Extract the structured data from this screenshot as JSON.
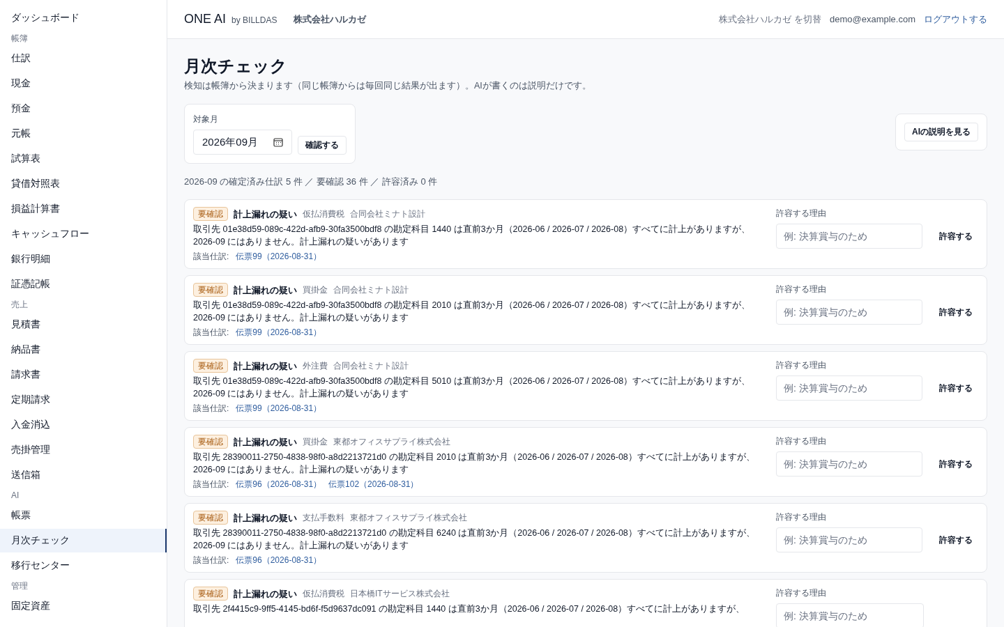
{
  "sidebar": {
    "items": [
      {
        "kind": "item",
        "label": "ダッシュボード",
        "selected": false
      },
      {
        "kind": "section",
        "label": "帳簿"
      },
      {
        "kind": "item",
        "label": "仕訳",
        "selected": false
      },
      {
        "kind": "item",
        "label": "現金",
        "selected": false
      },
      {
        "kind": "item",
        "label": "預金",
        "selected": false
      },
      {
        "kind": "item",
        "label": "元帳",
        "selected": false
      },
      {
        "kind": "item",
        "label": "試算表",
        "selected": false
      },
      {
        "kind": "item",
        "label": "貸借対照表",
        "selected": false
      },
      {
        "kind": "item",
        "label": "損益計算書",
        "selected": false
      },
      {
        "kind": "item",
        "label": "キャッシュフロー",
        "selected": false
      },
      {
        "kind": "item",
        "label": "銀行明細",
        "selected": false
      },
      {
        "kind": "item",
        "label": "証憑記帳",
        "selected": false
      },
      {
        "kind": "section",
        "label": "売上"
      },
      {
        "kind": "item",
        "label": "見積書",
        "selected": false
      },
      {
        "kind": "item",
        "label": "納品書",
        "selected": false
      },
      {
        "kind": "item",
        "label": "請求書",
        "selected": false
      },
      {
        "kind": "item",
        "label": "定期請求",
        "selected": false
      },
      {
        "kind": "item",
        "label": "入金消込",
        "selected": false
      },
      {
        "kind": "item",
        "label": "売掛管理",
        "selected": false
      },
      {
        "kind": "item",
        "label": "送信箱",
        "selected": false
      },
      {
        "kind": "section",
        "label": "AI"
      },
      {
        "kind": "item",
        "label": "帳票",
        "selected": false
      },
      {
        "kind": "item",
        "label": "月次チェック",
        "selected": true
      },
      {
        "kind": "item",
        "label": "移行センター",
        "selected": false
      },
      {
        "kind": "section",
        "label": "管理"
      },
      {
        "kind": "item",
        "label": "固定資産",
        "selected": false
      }
    ]
  },
  "header": {
    "brand": "ONE AI",
    "brand_suffix": "by BILLDAS",
    "company": "株式会社ハルカゼ",
    "switch_link": "株式会社ハルカゼ を切替",
    "email": "demo@example.com",
    "logout": "ログアウトする"
  },
  "page": {
    "title": "月次チェック",
    "subtitle": "検知は帳簿から決まります（同じ帳簿からは毎回同じ結果が出ます）。AIが書くのは説明だけです。",
    "month_label": "対象月",
    "month_value": "2026年09月",
    "confirm_button": "確認する",
    "ai_button": "AIの説明を見る",
    "summary": "2026-09 の確定済み仕訳 5 件 ／ 要確認 36 件 ／ 許容済み 0 件"
  },
  "findings": [
    {
      "badge": "要確認",
      "title": "計上漏れの疑い",
      "account": "仮払消費税",
      "partner": "合同会社ミナト設計",
      "description": "取引先 01e38d59-089c-422d-afb9-30fa3500bdf8 の勘定科目 1440 は直前3か月（2026-06 / 2026-07 / 2026-08）すべてに計上がありますが、2026-09 にはありません。計上漏れの疑いがあります",
      "refs_label": "該当仕訳:",
      "refs": [
        "伝票99（2026-08-31）"
      ],
      "reason_label": "許容する理由",
      "reason_placeholder": "例: 決算賞与のため",
      "allow_button": "許容する"
    },
    {
      "badge": "要確認",
      "title": "計上漏れの疑い",
      "account": "買掛金",
      "partner": "合同会社ミナト設計",
      "description": "取引先 01e38d59-089c-422d-afb9-30fa3500bdf8 の勘定科目 2010 は直前3か月（2026-06 / 2026-07 / 2026-08）すべてに計上がありますが、2026-09 にはありません。計上漏れの疑いがあります",
      "refs_label": "該当仕訳:",
      "refs": [
        "伝票99（2026-08-31）"
      ],
      "reason_label": "許容する理由",
      "reason_placeholder": "例: 決算賞与のため",
      "allow_button": "許容する"
    },
    {
      "badge": "要確認",
      "title": "計上漏れの疑い",
      "account": "外注費",
      "partner": "合同会社ミナト設計",
      "description": "取引先 01e38d59-089c-422d-afb9-30fa3500bdf8 の勘定科目 5010 は直前3か月（2026-06 / 2026-07 / 2026-08）すべてに計上がありますが、2026-09 にはありません。計上漏れの疑いがあります",
      "refs_label": "該当仕訳:",
      "refs": [
        "伝票99（2026-08-31）"
      ],
      "reason_label": "許容する理由",
      "reason_placeholder": "例: 決算賞与のため",
      "allow_button": "許容する"
    },
    {
      "badge": "要確認",
      "title": "計上漏れの疑い",
      "account": "買掛金",
      "partner": "東都オフィスサプライ株式会社",
      "description": "取引先 28390011-2750-4838-98f0-a8d2213721d0 の勘定科目 2010 は直前3か月（2026-06 / 2026-07 / 2026-08）すべてに計上がありますが、2026-09 にはありません。計上漏れの疑いがあります",
      "refs_label": "該当仕訳:",
      "refs": [
        "伝票96（2026-08-31）",
        "伝票102（2026-08-31）"
      ],
      "reason_label": "許容する理由",
      "reason_placeholder": "例: 決算賞与のため",
      "allow_button": "許容する"
    },
    {
      "badge": "要確認",
      "title": "計上漏れの疑い",
      "account": "支払手数料",
      "partner": "東都オフィスサプライ株式会社",
      "description": "取引先 28390011-2750-4838-98f0-a8d2213721d0 の勘定科目 6240 は直前3か月（2026-06 / 2026-07 / 2026-08）すべてに計上がありますが、2026-09 にはありません。計上漏れの疑いがあります",
      "refs_label": "該当仕訳:",
      "refs": [
        "伝票96（2026-08-31）"
      ],
      "reason_label": "許容する理由",
      "reason_placeholder": "例: 決算賞与のため",
      "allow_button": "許容する"
    },
    {
      "badge": "要確認",
      "title": "計上漏れの疑い",
      "account": "仮払消費税",
      "partner": "日本橋ITサービス株式会社",
      "description": "取引先 2f4415c9-9ff5-4145-bd6f-f5d9637dc091 の勘定科目 1440 は直前3か月（2026-06 / 2026-07 / 2026-08）すべてに計上がありますが、",
      "reason_label": "許容する理由",
      "reason_placeholder": "例: 決算賞与のため"
    }
  ]
}
